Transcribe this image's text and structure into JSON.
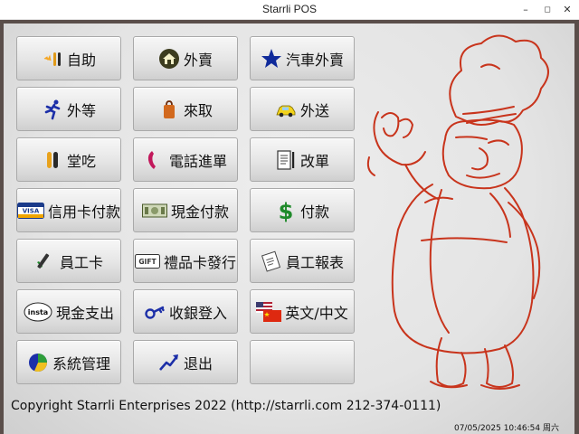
{
  "window": {
    "title": "Starrli POS",
    "minimize": "–",
    "maximize": "◻",
    "close": "✕"
  },
  "buttons": [
    {
      "label": "自助",
      "icon": "self-service-icon"
    },
    {
      "label": "外賣",
      "icon": "home-icon"
    },
    {
      "label": "汽車外賣",
      "icon": "star-icon"
    },
    {
      "label": "外等",
      "icon": "running-man-icon"
    },
    {
      "label": "來取",
      "icon": "bag-icon"
    },
    {
      "label": "外送",
      "icon": "car-icon"
    },
    {
      "label": "堂吃",
      "icon": "cutlery-icon"
    },
    {
      "label": "電話進單",
      "icon": "phone-icon"
    },
    {
      "label": "改單",
      "icon": "receipt-icon"
    },
    {
      "label": "信用卡付款",
      "icon": "visa-card-icon",
      "badge": "VISA"
    },
    {
      "label": "現金付款",
      "icon": "cash-icon"
    },
    {
      "label": "付款",
      "icon": "dollar-icon",
      "badge": "$"
    },
    {
      "label": "員工卡",
      "icon": "swipe-card-icon"
    },
    {
      "label": "禮品卡發行",
      "icon": "gift-card-icon",
      "badge": "GIFT"
    },
    {
      "label": "員工報表",
      "icon": "report-icon"
    },
    {
      "label": "現金支出",
      "icon": "insta-cash-icon",
      "badge": "insta"
    },
    {
      "label": "收銀登入",
      "icon": "key-icon"
    },
    {
      "label": "英文/中文",
      "icon": "flags-icon"
    },
    {
      "label": "系統管理",
      "icon": "pie-chart-icon"
    },
    {
      "label": "退出",
      "icon": "exit-arrow-icon"
    },
    {
      "label": "",
      "icon": ""
    }
  ],
  "footer": {
    "copyright": "Copyright Starrli Enterprises 2022  (http://starrli.com 212-374-0111)"
  },
  "status": {
    "datetime": "07/05/2025 10:46:54 周六"
  },
  "colors": {
    "chef_line": "#c8341c",
    "frame": "#5a4e4a",
    "button_border": "#a9a9a9"
  }
}
